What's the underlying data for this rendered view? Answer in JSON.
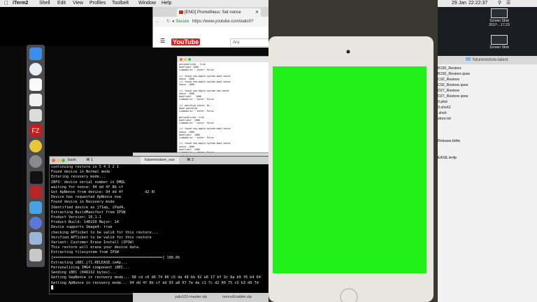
{
  "menubar": {
    "apple": "",
    "items": [
      "iTerm2",
      "Shell",
      "Edit",
      "View",
      "Profiles",
      "Toolbelt",
      "Window",
      "Help"
    ],
    "right_date": "29 Jan",
    "right_time": "22:22:37"
  },
  "browser": {
    "tab_title": "[ENG] Prometheus: Set nonce",
    "secure_label": "Secure",
    "url": "https://www.youtube.com/watch?",
    "logo_text": "YouTube",
    "search_placeholder": "Ara"
  },
  "terminal_small": {
    "title": "1. futurerestore_osx",
    "lines": [
      "personalized   true",
      "bootlimit 1000",
      "Libmobile> ~ enter~ Force",
      "",
      "(i) found sep.apple.system.boot.nonce",
      "nonce  1000",
      "(i) found sep.apple.system.boot.nonce",
      "nonce  1000",
      "",
      "(i) found sep.apple.system.sep.nonce",
      "nonce  1000",
      "bootlimit   1000",
      "Libmobile> ~ enter~ Force",
      "",
      "(i) patching nonce: 0x...",
      "done patching",
      "Libmobile> ~ enter~ Force",
      "",
      "personalized  true",
      "bootlimit  1000",
      "Libmobile> ~ enter~ Force",
      "",
      "(i) found sep.apple.system.boot.nonce",
      "nonce  1000",
      "bootlimit  1000",
      "Libmobile> ~ enter~ Force",
      "",
      "(i) found sep.apple.system.boot.nonce",
      "nonce  1000",
      "bootlimit  1000",
      "Libmobile> ~ enter~ Force"
    ]
  },
  "terminal_main": {
    "tabs": [
      "bash",
      "⌘ 1",
      "futurerestore_osx",
      "⌘ 2"
    ],
    "lines": [
      "continuing restore in 5 4 3 2 1",
      "Found device in Normal mode",
      "Entering recovery mode...",
      "INFO: device serial number is DMQL",
      "waiting for nonce: 94 dd 4f 8b cf                75 c5 b3 d9 7d",
      "Got ApNonce from device: 94 dd 4f          d2 80 75 c5 b3 d9 7d",
      "Device has requested ApNonce now",
      "Found device in Recovery mode",
      "Identified device as j71ap, iPad4,",
      "Extracting BuildManifest from IPSW",
      "Product Version: 10.1.1",
      "Product Build: 14B150 Major: 14",
      "Device supports Image4: true",
      "checking APTicket to be valid for this restore...",
      "Verified APTicket to be valid for this restore",
      "Variant: Customer Erase Install (IPSW)",
      "This restore will erase your device data.",
      "Extracting filesystem from IPSW",
      "[==================================================] 100.0%",
      "Extracting iBEC.j71.RELEASE.im4p...",
      "Personalizing IMG4 component iBEC...",
      "Sending iBEC (0461S2 bytes)...",
      "Getting SepNonce in recovery mode... 98 cd c6 d6 74 86 c5 da 48 bb 92 e8 17 bf 3c 8a b9 f6 b4 64",
      "Getting ApNonce in recovery mode... 94 dd 4f 8b cf dd 93 a8 07 7e de c1 7c d2 80 75 c5 b3 d9 7d",
      "█"
    ]
  },
  "downloads": {
    "items": [
      "yalu102-master.zip",
      "nonceEnabler.zip"
    ]
  },
  "right_desktop": {
    "shot_label_1": "Screen Shot",
    "shot_label_1b": "2017-...17.23",
    "shot_label_2": "Screen Shot"
  },
  "finder": {
    "title": "futurerestore-latest",
    "items": [
      "B150_Restore",
      "B150_Restore.ipsw",
      "C92_Restore",
      "C92_Restore.ipsw",
      "D27_Restore",
      "D27_Restore.ipsw",
      "0.plist",
      "0.shsh2",
      ".shsh",
      "store.txt",
      "",
      "",
      "",
      "Release.bbfw",
      "",
      "",
      "EASE.im4p"
    ]
  },
  "colors": {
    "ipad_screen": "#22f019",
    "terminal_bg": "#000000"
  }
}
